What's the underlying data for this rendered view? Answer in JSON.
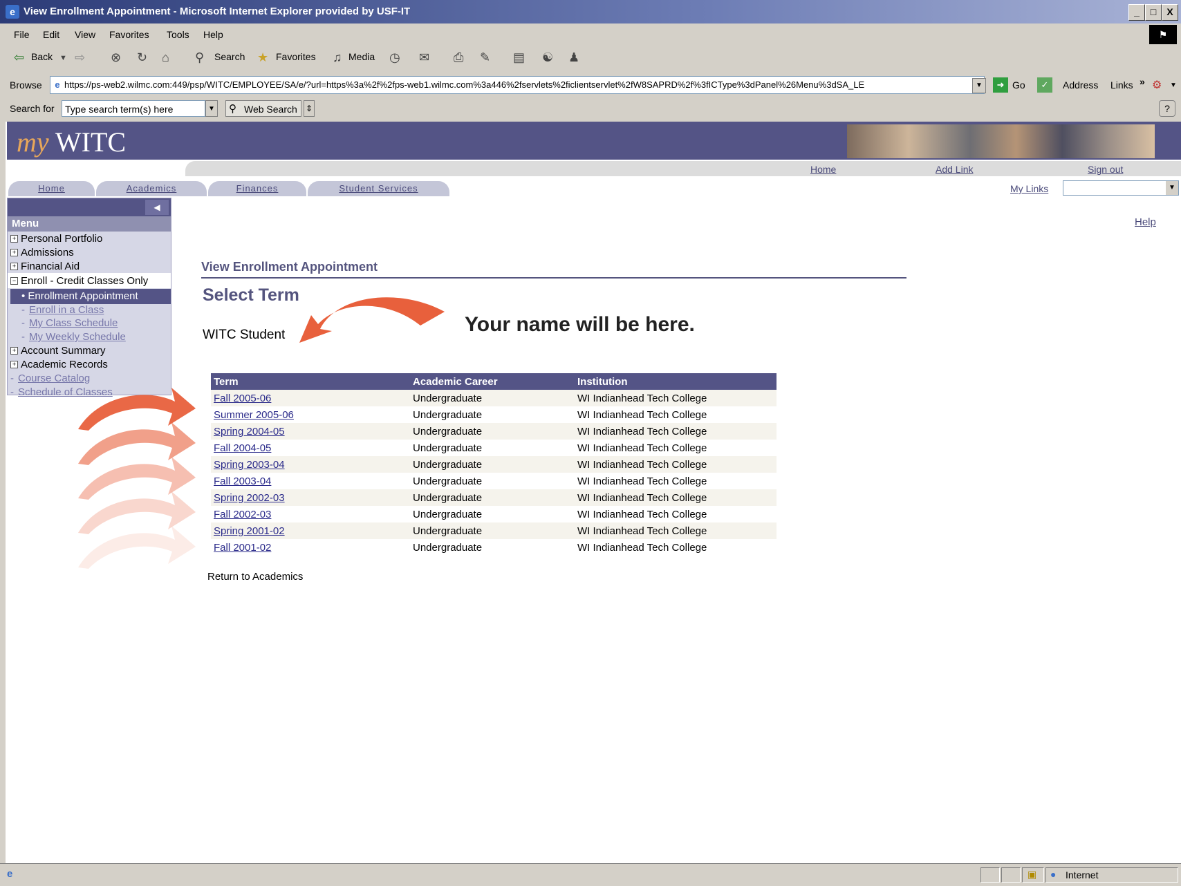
{
  "window": {
    "title": "View Enrollment Appointment - Microsoft Internet Explorer provided by USF-IT",
    "controls": [
      "_",
      "□",
      "X"
    ]
  },
  "menubar": {
    "items": [
      "File",
      "Edit",
      "View",
      "Favorites",
      "Tools",
      "Help"
    ]
  },
  "toolbar": {
    "back": "Back",
    "search": "Search",
    "favorites": "Favorites",
    "media": "Media"
  },
  "addressbar": {
    "browse_label": "Browse",
    "url": "https://ps-web2.wilmc.com:449/psp/WITC/EMPLOYEE/SA/e/?url=https%3a%2f%2fps-web1.wilmc.com%3a446%2fservlets%2ficlientservlet%2fW8SAPRD%2f%3fICType%3dPanel%26Menu%3dSA_LE",
    "go": "Go",
    "address": "Address",
    "links": "Links"
  },
  "searchbar": {
    "label": "Search for",
    "placeholder": "Type search term(s) here",
    "button": "Web Search"
  },
  "portal": {
    "logo_my": "my",
    "logo_name": "WITC",
    "util_links": [
      "Home",
      "Add Link",
      "Sign out"
    ],
    "tabs": [
      "Home",
      "Academics",
      "Finances",
      "Student Services"
    ],
    "mylinks": "My Links",
    "help": "Help"
  },
  "menu": {
    "header": "Menu",
    "items": [
      {
        "label": "Personal Portfolio",
        "icon": "+"
      },
      {
        "label": "Admissions",
        "icon": "+"
      },
      {
        "label": "Financial Aid",
        "icon": "+"
      },
      {
        "label": "Enroll - Credit Classes Only",
        "icon": "−"
      }
    ],
    "subitems": [
      "Enrollment Appointment",
      "Enroll in a Class",
      "My Class Schedule",
      "My Weekly Schedule"
    ],
    "items2": [
      {
        "label": "Account Summary",
        "icon": "+"
      },
      {
        "label": "Academic Records",
        "icon": "+"
      }
    ],
    "links": [
      "Course Catalog",
      "Schedule of Classes"
    ]
  },
  "main": {
    "page_title": "View Enrollment Appointment",
    "select_term": "Select Term",
    "student_name": "WITC Student",
    "callout": "Your name will be here.",
    "table": {
      "headers": [
        "Term",
        "Academic Career",
        "Institution"
      ],
      "rows": [
        [
          "Fall 2005-06",
          "Undergraduate",
          "WI Indianhead Tech College"
        ],
        [
          "Summer 2005-06",
          "Undergraduate",
          "WI Indianhead Tech College"
        ],
        [
          "Spring 2004-05",
          "Undergraduate",
          "WI Indianhead Tech College"
        ],
        [
          "Fall 2004-05",
          "Undergraduate",
          "WI Indianhead Tech College"
        ],
        [
          "Spring 2003-04",
          "Undergraduate",
          "WI Indianhead Tech College"
        ],
        [
          "Fall 2003-04",
          "Undergraduate",
          "WI Indianhead Tech College"
        ],
        [
          "Spring 2002-03",
          "Undergraduate",
          "WI Indianhead Tech College"
        ],
        [
          "Fall 2002-03",
          "Undergraduate",
          "WI Indianhead Tech College"
        ],
        [
          "Spring 2001-02",
          "Undergraduate",
          "WI Indianhead Tech College"
        ],
        [
          "Fall 2001-02",
          "Undergraduate",
          "WI Indianhead Tech College"
        ]
      ]
    },
    "return_link": "Return to Academics"
  },
  "statusbar": {
    "zone": "Internet"
  },
  "colors": {
    "brand": "#545486",
    "arrow": "#e8603c",
    "accent_logo": "#e8a75a"
  }
}
